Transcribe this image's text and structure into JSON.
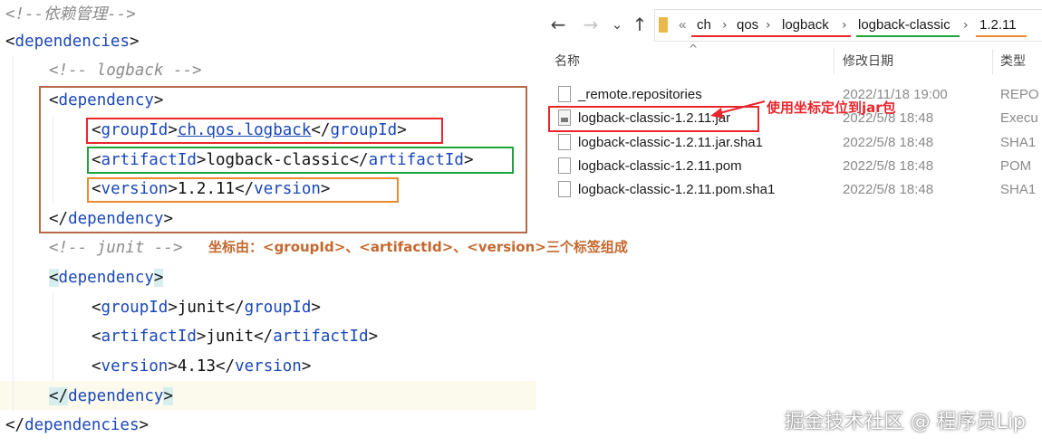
{
  "editor": {
    "comment_deps": "<!--依赖管理-->",
    "dependencies_tag": "dependencies",
    "comment_logback": "<!-- logback -->",
    "comment_junit": "<!-- junit -->",
    "dependency_tag": "dependency",
    "groupId_tag": "groupId",
    "artifactId_tag": "artifactId",
    "version_tag": "version",
    "logback": {
      "groupId": "ch.qos.logback",
      "artifactId": "logback-classic",
      "version": "1.2.11"
    },
    "junit": {
      "groupId": "junit",
      "artifactId": "junit",
      "version": "4.13"
    }
  },
  "annotations": {
    "coordinate_note": "坐标由：<groupId>、<artifactId>、<version>三个标签组成",
    "jar_note": "使用坐标定位到jar包",
    "colors": {
      "red": "#e8262d",
      "green": "#1fa33b",
      "orange": "#ef8a2e",
      "brown": "#b7694a"
    }
  },
  "explorer": {
    "nav": {
      "back": "←",
      "forward": "→",
      "dropdown": "⌄",
      "up": "↑"
    },
    "breadcrumb": {
      "overflow": "«",
      "separator": "›",
      "items": [
        "ch",
        "qos",
        "logback",
        "logback-classic",
        "1.2.11"
      ]
    },
    "columns": {
      "name": "名称",
      "modified": "修改日期",
      "type": "类型"
    },
    "files": [
      {
        "name": "_remote.repositories",
        "date": "2022/11/18 19:00",
        "type": "REPO",
        "icon": "file-icon"
      },
      {
        "name": "logback-classic-1.2.11.jar",
        "date": "2022/5/8 18:48",
        "type": "Execu",
        "icon": "jar-icon"
      },
      {
        "name": "logback-classic-1.2.11.jar.sha1",
        "date": "2022/5/8 18:48",
        "type": "SHA1",
        "icon": "file-icon"
      },
      {
        "name": "logback-classic-1.2.11.pom",
        "date": "2022/5/8 18:48",
        "type": "POM",
        "icon": "file-icon"
      },
      {
        "name": "logback-classic-1.2.11.pom.sha1",
        "date": "2022/5/8 18:48",
        "type": "SHA1",
        "icon": "file-icon"
      }
    ]
  },
  "watermark": "掘金技术社区 @ 程序员Lip"
}
